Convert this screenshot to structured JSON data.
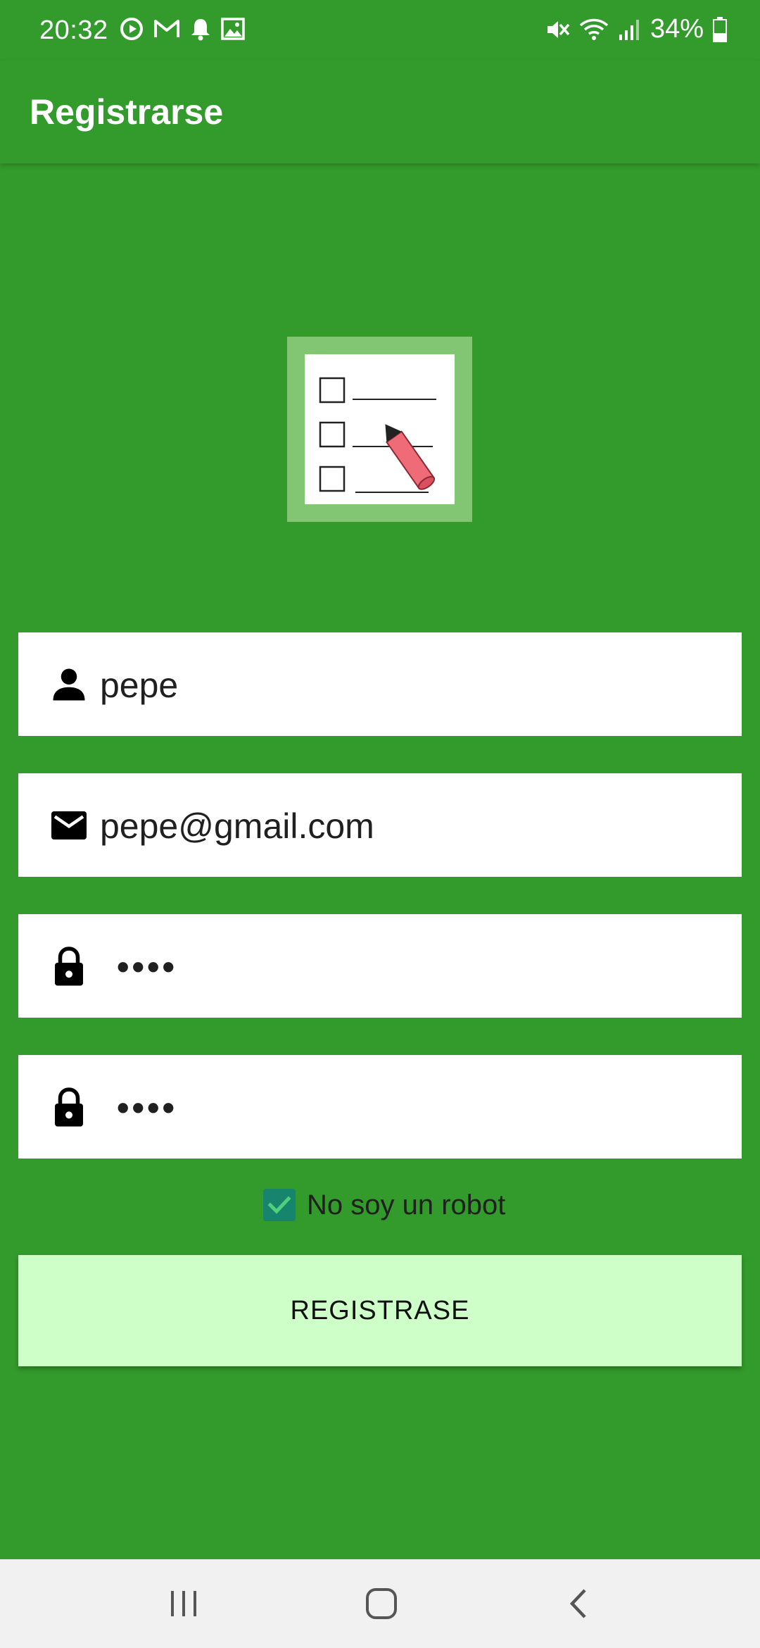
{
  "status_bar": {
    "time": "20:32",
    "battery_percent": "34%",
    "left_icons": [
      "media-icon",
      "gmail-icon",
      "bell-icon",
      "gallery-icon"
    ],
    "right_icons": [
      "mute-icon",
      "wifi-icon",
      "signal-icon",
      "battery-icon"
    ]
  },
  "app_bar": {
    "title": "Registrarse"
  },
  "logo": {
    "icon": "checklist-icon"
  },
  "form": {
    "username": {
      "icon": "person-icon",
      "value": "pepe"
    },
    "email": {
      "icon": "mail-icon",
      "value": "pepe@gmail.com"
    },
    "password": {
      "icon": "lock-icon",
      "value": "••••"
    },
    "password_confirm": {
      "icon": "lock-icon",
      "value": "••••"
    },
    "captcha": {
      "label": "No soy un robot",
      "checked": true
    },
    "submit_label": "REGISTRASE"
  },
  "nav_bar": {
    "items": [
      "recents-button",
      "home-button",
      "back-button"
    ]
  },
  "colors": {
    "primary": "#339a2c",
    "button_bg": "#cfffc8",
    "checkbox": "#17846d",
    "logo_frame": "#82c673"
  }
}
